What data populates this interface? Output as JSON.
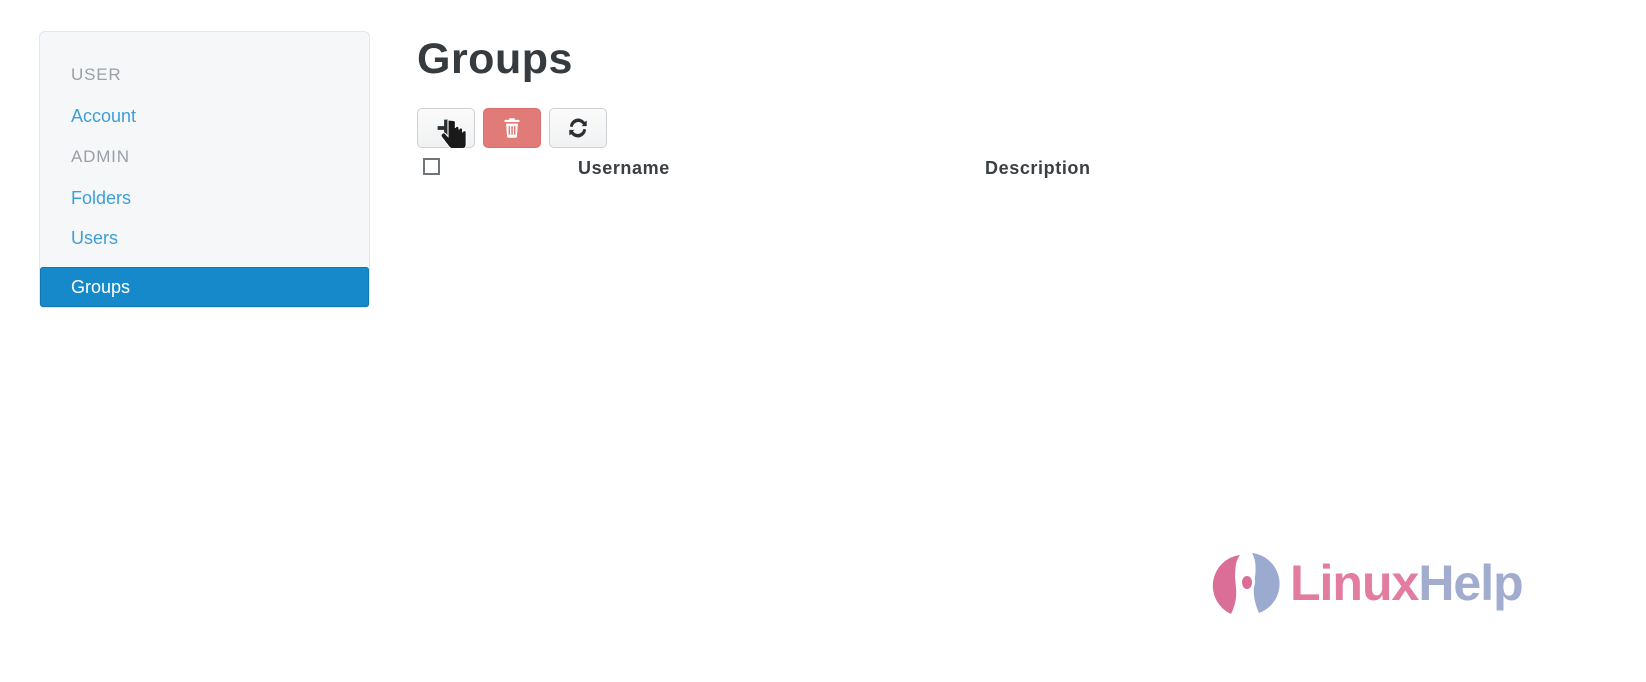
{
  "sidebar": {
    "items": [
      {
        "label": "USER",
        "type": "section",
        "active": false
      },
      {
        "label": "Account",
        "type": "link",
        "active": false
      },
      {
        "label": "ADMIN",
        "type": "section",
        "active": false
      },
      {
        "label": "Folders",
        "type": "link",
        "active": false
      },
      {
        "label": "Users",
        "type": "link",
        "active": false
      },
      {
        "label": "Groups",
        "type": "link",
        "active": true
      }
    ]
  },
  "main": {
    "title": "Groups",
    "toolbar": {
      "add": {
        "label": "",
        "icon": "plus-icon",
        "title": "Add group"
      },
      "delete": {
        "label": "",
        "icon": "trash-icon",
        "title": "Delete group"
      },
      "refresh": {
        "label": "",
        "icon": "refresh-icon",
        "title": "Refresh"
      }
    },
    "table": {
      "select_all_checked": false,
      "columns": [
        "Username",
        "Description"
      ],
      "rows": []
    }
  },
  "watermark": {
    "text_primary": "Linux",
    "text_secondary": "Help"
  },
  "colors": {
    "accent_active": "#1589c9",
    "link": "#3c9fd6",
    "section_label": "#9aa0a6",
    "danger": "#e07b77",
    "sidebar_bg": "#f6f7f9",
    "page_bg": "#ffffff",
    "title": "#363b3f",
    "logo_pink": "#e0719a",
    "logo_blue": "#9aa6cb"
  }
}
